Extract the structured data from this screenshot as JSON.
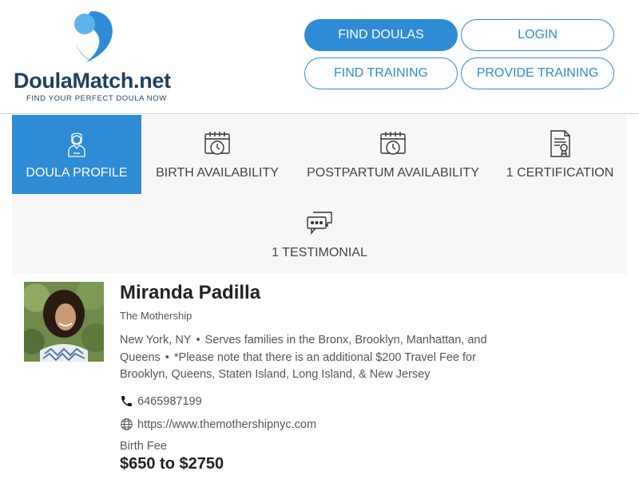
{
  "brand": {
    "name_main": "DoulaMatch",
    "name_suffix": ".net",
    "tagline": "FIND YOUR PERFECT DOULA NOW",
    "colors": {
      "primary": "#2e8bd6",
      "light": "#5fb3ec",
      "dark": "#1f3f5e"
    }
  },
  "nav": {
    "find_doulas": "FIND DOULAS",
    "login": "LOGIN",
    "find_training": "FIND TRAINING",
    "provide_training": "PROVIDE TRAINING"
  },
  "tabs": [
    {
      "label": "DOULA PROFILE",
      "icon": "person-icon",
      "active": true
    },
    {
      "label": "BIRTH AVAILABILITY",
      "icon": "calendar-clock-icon",
      "active": false
    },
    {
      "label": "POSTPARTUM AVAILABILITY",
      "icon": "calendar-clock-icon",
      "active": false
    },
    {
      "label": "1 CERTIFICATION",
      "icon": "certificate-icon",
      "active": false
    },
    {
      "label": "1 TESTIMONIAL",
      "icon": "chat-bubbles-icon",
      "active": false
    }
  ],
  "profile": {
    "name": "Miranda Padilla",
    "organization": "The Mothership",
    "location": "New York, NY",
    "service_area": "Serves families in the Bronx, Brooklyn, Manhattan, and Queens",
    "note": "*Please note that there is an additional $200 Travel Fee for Brooklyn, Queens, Staten Island, Long Island, & New Jersey",
    "phone": "6465987199",
    "website": "https://www.themothershipnyc.com",
    "fee_label": "Birth Fee",
    "fee_value": "$650 to $2750"
  }
}
